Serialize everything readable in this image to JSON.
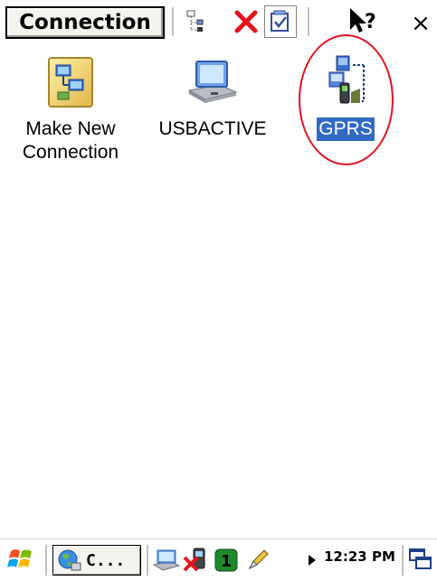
{
  "toolbar": {
    "menu_label": "Connection",
    "help_label": "?",
    "close_label": "×"
  },
  "items": [
    {
      "label_line1": "Make New",
      "label_line2": "Connection"
    },
    {
      "label_line1": "USBACTIVE",
      "label_line2": ""
    },
    {
      "label_line1": "GPRS",
      "label_line2": ""
    }
  ],
  "selected_item": "GPRS",
  "taskbar": {
    "task_label": "C...",
    "clock": "12:23 PM",
    "signal_badge": "1"
  },
  "colors": {
    "selection": "#316ac5",
    "annotation_ring": "#e0141e"
  }
}
